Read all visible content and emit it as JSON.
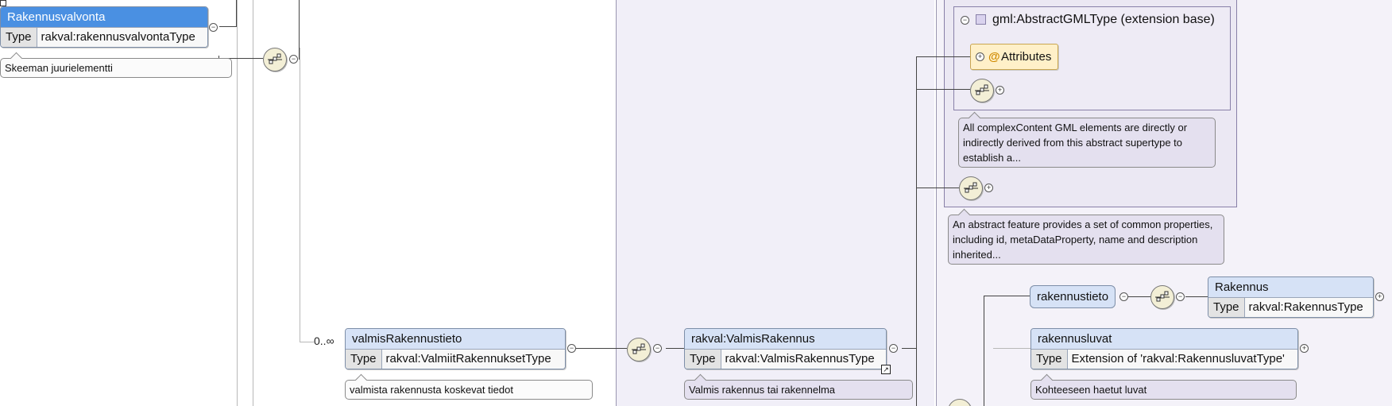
{
  "labels": {
    "type": "Type"
  },
  "root": {
    "name": "Rakennusvalvonta",
    "type": "rakval:rakennusvalvontaType",
    "note": "Skeeman juurielementti"
  },
  "valmisRakennustieto": {
    "occurs": "0..∞",
    "name": "valmisRakennustieto",
    "type": "rakval:ValmiitRakennuksetType",
    "note": "valmista rakennusta koskevat tiedot"
  },
  "valmisRakennus": {
    "name": "rakval:ValmisRakennus",
    "type": "rakval:ValmisRakennusType",
    "note": "Valmis rakennus tai rakennelma"
  },
  "gmlBase": {
    "title": "gml:AbstractGMLType (extension base)",
    "attributes_label": "Attributes",
    "note": "All complexContent GML elements are directly or indirectly derived from this abstract supertype to establish a..."
  },
  "abstractFeature": {
    "note": "An abstract feature provides a set of common properties, including id, metaDataProperty, name and description inherited..."
  },
  "rakennustieto": {
    "name": "rakennustieto"
  },
  "rakennus": {
    "name": "Rakennus",
    "type": "rakval:RakennusType"
  },
  "rakennusluvat": {
    "name": "rakennusluvat",
    "type": "Extension of 'rakval:RakennusluvatType'",
    "note": "Kohteeseen haetut luvat"
  }
}
